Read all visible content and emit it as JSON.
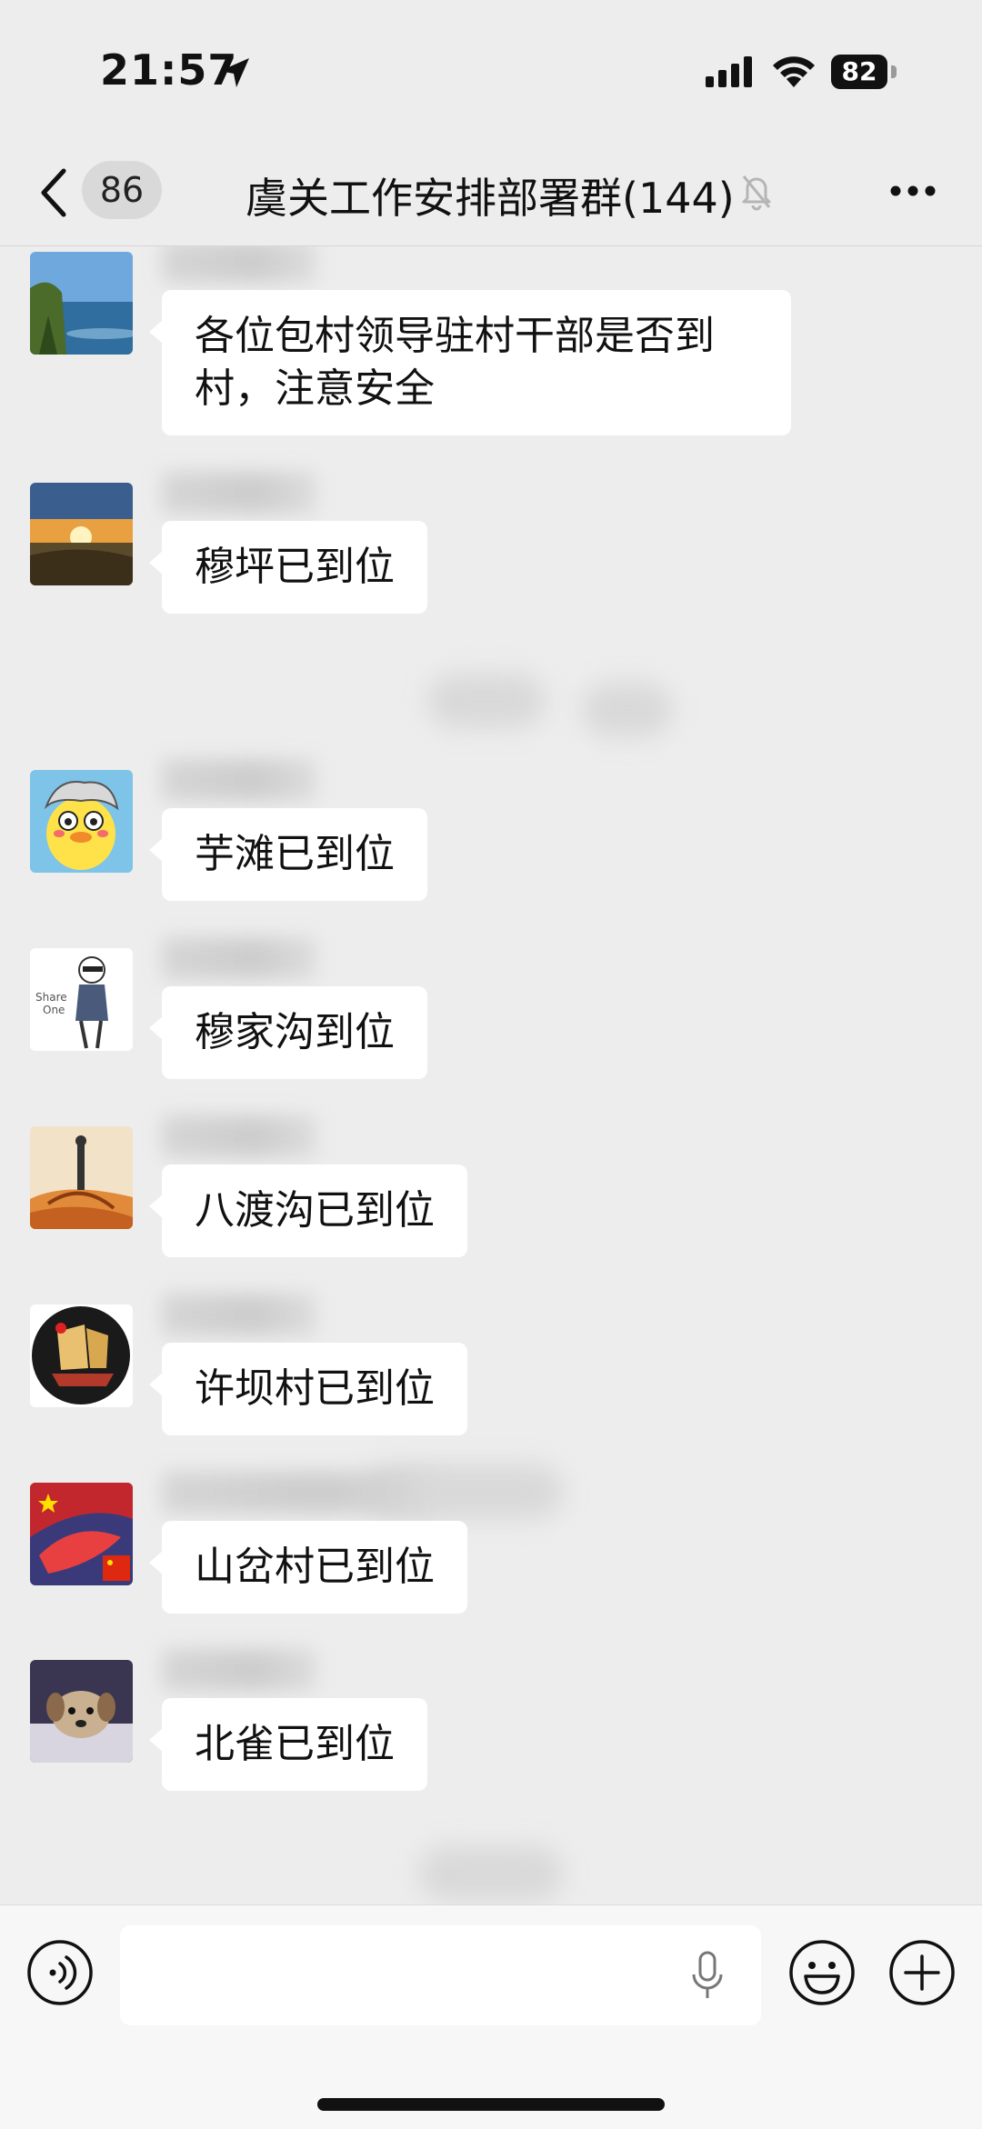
{
  "status_bar": {
    "time": "21:57",
    "battery": "82"
  },
  "nav": {
    "unread_count": "86",
    "title": "虞关工作安排部署群(144)"
  },
  "messages": [
    {
      "text": "各位包村领导驻村干部是否到村，注意安全",
      "avatar": "ocean-coast"
    },
    {
      "text": "穆坪已到位",
      "avatar": "sunset"
    },
    {
      "text": "芋滩已到位",
      "avatar": "cartoon-duck"
    },
    {
      "text": "穆家沟到位",
      "avatar": "sketch-man"
    },
    {
      "text": "八渡沟已到位",
      "avatar": "desert-figure"
    },
    {
      "text": "许坝村已到位",
      "avatar": "sailing-ship"
    },
    {
      "text": "山岔村已到位",
      "avatar": "flag"
    },
    {
      "text": "北雀已到位",
      "avatar": "puppy"
    }
  ],
  "input": {
    "placeholder": ""
  },
  "colors": {
    "background": "#ededed",
    "bubble": "#ffffff",
    "input_bar": "#f7f7f7"
  }
}
